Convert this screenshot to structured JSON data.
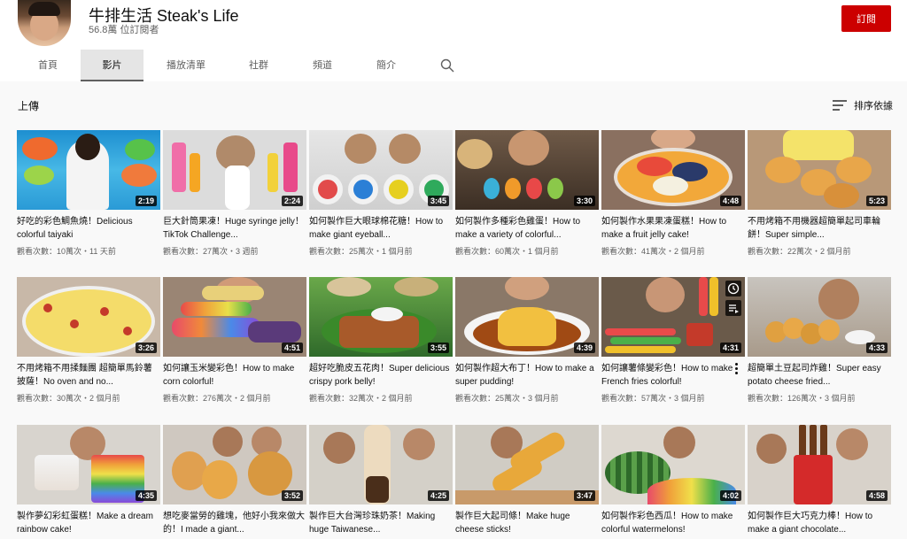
{
  "channel": {
    "title": "牛排生活 Steak's Life",
    "subscribers": "56.8萬 位訂閱者",
    "subscribe_label": "訂閱"
  },
  "tabs": [
    {
      "label": "首頁",
      "active": false
    },
    {
      "label": "影片",
      "active": true
    },
    {
      "label": "播放清單",
      "active": false
    },
    {
      "label": "社群",
      "active": false
    },
    {
      "label": "頻道",
      "active": false
    },
    {
      "label": "簡介",
      "active": false
    }
  ],
  "section": {
    "title": "上傳",
    "sort_label": "排序依據"
  },
  "videos": [
    {
      "title": "好吃的彩色鯛魚燒！Delicious colorful taiyaki",
      "duration": "2:19",
      "meta": "觀看次數：10萬次・11 天前"
    },
    {
      "title": "巨大針筒果凍！Huge syringe jelly！TikTok Challenge...",
      "duration": "2:24",
      "meta": "觀看次數：27萬次・3 週前"
    },
    {
      "title": "如何製作巨大眼球棉花糖！How to make giant eyeball...",
      "duration": "3:45",
      "meta": "觀看次數：25萬次・1 個月前"
    },
    {
      "title": "如何製作多種彩色雞蛋！How to make a variety of colorful...",
      "duration": "3:30",
      "meta": "觀看次數：60萬次・1 個月前"
    },
    {
      "title": "如何製作水果果凍蛋糕！How to make a fruit jelly cake!",
      "duration": "4:48",
      "meta": "觀看次數：41萬次・2 個月前"
    },
    {
      "title": "不用烤箱不用機器超簡單起司車輪餅！Super simple...",
      "duration": "5:23",
      "meta": "觀看次數：22萬次・2 個月前"
    },
    {
      "title": "不用烤箱不用揉麵團 超簡單馬鈴薯披薩！No oven and no...",
      "duration": "3:26",
      "meta": "觀看次數：30萬次・2 個月前"
    },
    {
      "title": "如何讓玉米變彩色！How to make corn colorful!",
      "duration": "4:51",
      "meta": "觀看次數：276萬次・2 個月前"
    },
    {
      "title": "超好吃脆皮五花肉！Super delicious crispy pork belly!",
      "duration": "3:55",
      "meta": "觀看次數：32萬次・2 個月前"
    },
    {
      "title": "如何製作超大布丁！How to make a super pudding!",
      "duration": "4:39",
      "meta": "觀看次數：25萬次・3 個月前"
    },
    {
      "title": "如何讓薯條變彩色！How to make French fries colorful!",
      "duration": "4:31",
      "meta": "觀看次數：57萬次・3 個月前"
    },
    {
      "title": "超簡單土豆起司炸雞！Super easy potato cheese fried...",
      "duration": "4:33",
      "meta": "觀看次數：126萬次・3 個月前"
    },
    {
      "title": "製作夢幻彩虹蛋糕！Make a dream rainbow cake!",
      "duration": "4:35",
      "meta": ""
    },
    {
      "title": "想吃麥當勞的雞塊，他好小我來做大的！I made a giant...",
      "duration": "3:52",
      "meta": ""
    },
    {
      "title": "製作巨大台灣珍珠奶茶！Making huge Taiwanese...",
      "duration": "4:25",
      "meta": ""
    },
    {
      "title": "製作巨大起司條！Make huge cheese sticks!",
      "duration": "3:47",
      "meta": ""
    },
    {
      "title": "如何製作彩色西瓜！How to make colorful watermelons!",
      "duration": "4:02",
      "meta": ""
    },
    {
      "title": "如何製作巨大巧克力棒！How to make a giant chocolate...",
      "duration": "4:58",
      "meta": ""
    }
  ],
  "colors": {
    "subscribe": "#cc0000",
    "tab_active_bg": "#e5e5e5"
  },
  "icons": [
    "search-icon",
    "sort-icon",
    "watch-later-icon",
    "add-to-queue-icon",
    "more-vert-icon"
  ]
}
